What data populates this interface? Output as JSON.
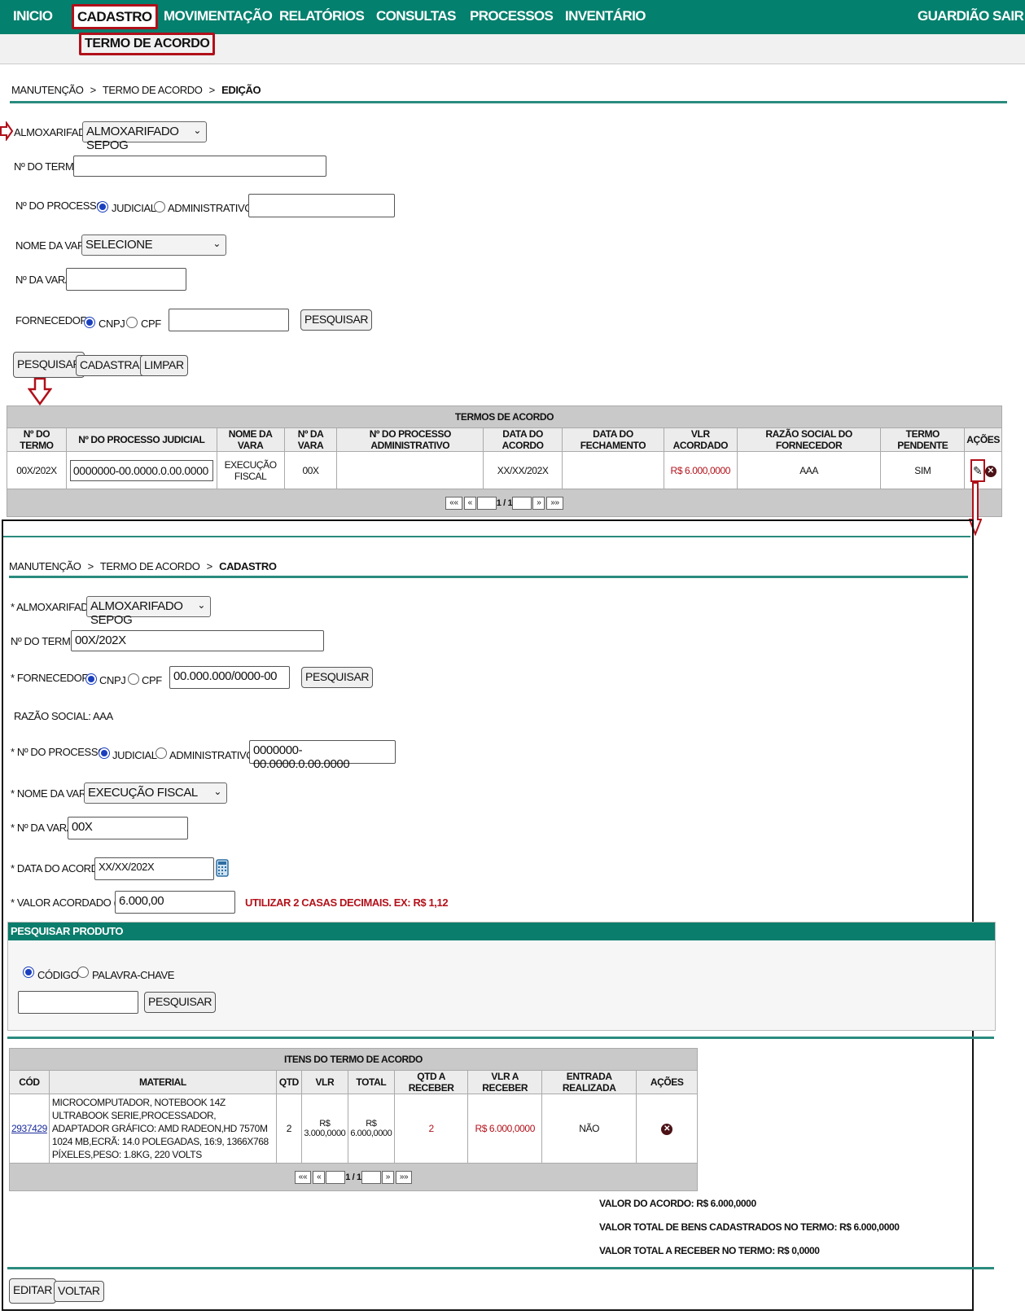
{
  "nav": {
    "items": [
      "INICIO",
      "CADASTRO",
      "MOVIMENTAÇÃO",
      "RELATÓRIOS",
      "CONSULTAS",
      "PROCESSOS",
      "INVENTÁRIO"
    ],
    "right": [
      "GUARDIÃO",
      "SAIR"
    ],
    "submenu": "TERMO DE ACORDO"
  },
  "search": {
    "breadcrumb": {
      "a": "MANUTENÇÃO",
      "b": "TERMO DE ACORDO",
      "c": "EDIÇÃO",
      "sep": ">"
    },
    "almox_label": "ALMOXARIFADO:",
    "almox_value": "ALMOXARIFADO SEPOG",
    "termo_label": "Nº DO TERMO:",
    "processo_label": "Nº DO PROCESSO:",
    "judicial": "JUDICIAL",
    "administrativo": "ADMINISTRATIVO",
    "vara_label": "NOME DA VARA:",
    "vara_value": "SELECIONE",
    "nvara_label": "Nº DA VARA:",
    "fornecedor_label": "FORNECEDOR:",
    "cnpj": "CNPJ",
    "cpf": "CPF",
    "pesquisar": "PESQUISAR",
    "cadastrar": "CADASTRAR",
    "limpar": "LIMPAR"
  },
  "results": {
    "caption": "TERMOS DE ACORDO",
    "headers": [
      "Nº DO TERMO",
      "Nº DO PROCESSO JUDICIAL",
      "NOME DA VARA",
      "Nº DA VARA",
      "Nº DO PROCESSO ADMINISTRATIVO",
      "DATA DO ACORDO",
      "DATA DO FECHAMENTO",
      "VLR ACORDADO",
      "RAZÃO SOCIAL DO FORNECEDOR",
      "TERMO PENDENTE",
      "AÇÕES"
    ],
    "row": {
      "termo": "00X/202X",
      "processo": "0000000-00.0000.0.00.0000",
      "vara": "EXECUÇÃO FISCAL",
      "nvara": "00X",
      "adm": "",
      "data": "XX/XX/202X",
      "fech": "",
      "vlr": "R$ 6.000,0000",
      "razao": "AAA",
      "pendente": "SIM"
    },
    "pager": {
      "first": "««",
      "prev": "«",
      "pages": "1 / 1",
      "next": "»",
      "last": "»»"
    }
  },
  "form": {
    "breadcrumb": {
      "a": "MANUTENÇÃO",
      "b": "TERMO DE ACORDO",
      "c": "CADASTRO",
      "sep": ">"
    },
    "almox_label": "* ALMOXARIFADO:",
    "almox_value": "ALMOXARIFADO SEPOG",
    "termo_label": "Nº DO TERMO:",
    "termo_value": "00X/202X",
    "fornecedor_label": "* FORNECEDOR:",
    "cnpj": "CNPJ",
    "cpf": "CPF",
    "fornecedor_value": "00.000.000/0000-00",
    "pesquisar": "PESQUISAR",
    "razao_social": "RAZÃO SOCIAL: AAA",
    "processo_label": "* Nº DO PROCESSO:",
    "judicial": "JUDICIAL",
    "administrativo": "ADMINISTRATIVO",
    "processo_value": "0000000-00.0000.0.00.0000",
    "vara_label": "* NOME DA VARA:",
    "vara_value": "EXECUÇÃO FISCAL",
    "nvara_label": "* Nº DA VARA:",
    "nvara_value": "00X",
    "data_label": "* DATA DO ACORDO:",
    "data_value": "XX/XX/202X",
    "valor_label": "* VALOR ACORDADO (R$):",
    "valor_value": "6.000,00",
    "valor_hint": "UTILIZAR 2 CASAS DECIMAIS. EX: R$ 1,12"
  },
  "produto": {
    "title": "PESQUISAR PRODUTO",
    "codigo": "CÓDIGO",
    "palavra": "PALAVRA-CHAVE",
    "pesquisar": "PESQUISAR"
  },
  "itens": {
    "caption": "ITENS DO TERMO DE ACORDO",
    "headers": [
      "CÓD",
      "MATERIAL",
      "QTD",
      "VLR",
      "TOTAL",
      "QTD A RECEBER",
      "VLR A RECEBER",
      "ENTRADA REALIZADA",
      "AÇÕES"
    ],
    "row": {
      "cod": "2937429",
      "material": "MICROCOMPUTADOR, NOTEBOOK 14Z ULTRABOOK SERIE,PROCESSADOR, ADAPTADOR GRÁFICO: AMD RADEON,HD 7570M 1024 MB,ECRÃ: 14.0 POLEGADAS, 16:9, 1366X768 PÍXELES,PESO: 1.8KG, 220 VOLTS",
      "qtd": "2",
      "vlr": "R$ 3.000,0000",
      "total": "R$ 6.000,0000",
      "qtd_receber": "2",
      "vlr_receber": "R$ 6.000,0000",
      "entrada": "NÃO"
    },
    "pager": {
      "first": "««",
      "prev": "«",
      "pages": "1 / 1",
      "next": "»",
      "last": "»»"
    }
  },
  "totais": {
    "valor_acordo": "VALOR DO ACORDO: R$ 6.000,0000",
    "valor_bens": "VALOR TOTAL DE BENS CADASTRADOS NO TERMO: R$ 6.000,0000",
    "valor_receber": "VALOR TOTAL A RECEBER NO TERMO: R$ 0,0000"
  },
  "actions": {
    "editar": "EDITAR",
    "voltar": "VOLTAR"
  },
  "colors": {
    "nav": "#04806e",
    "highlight": "#b0101a",
    "value_red": "#b3121b"
  }
}
